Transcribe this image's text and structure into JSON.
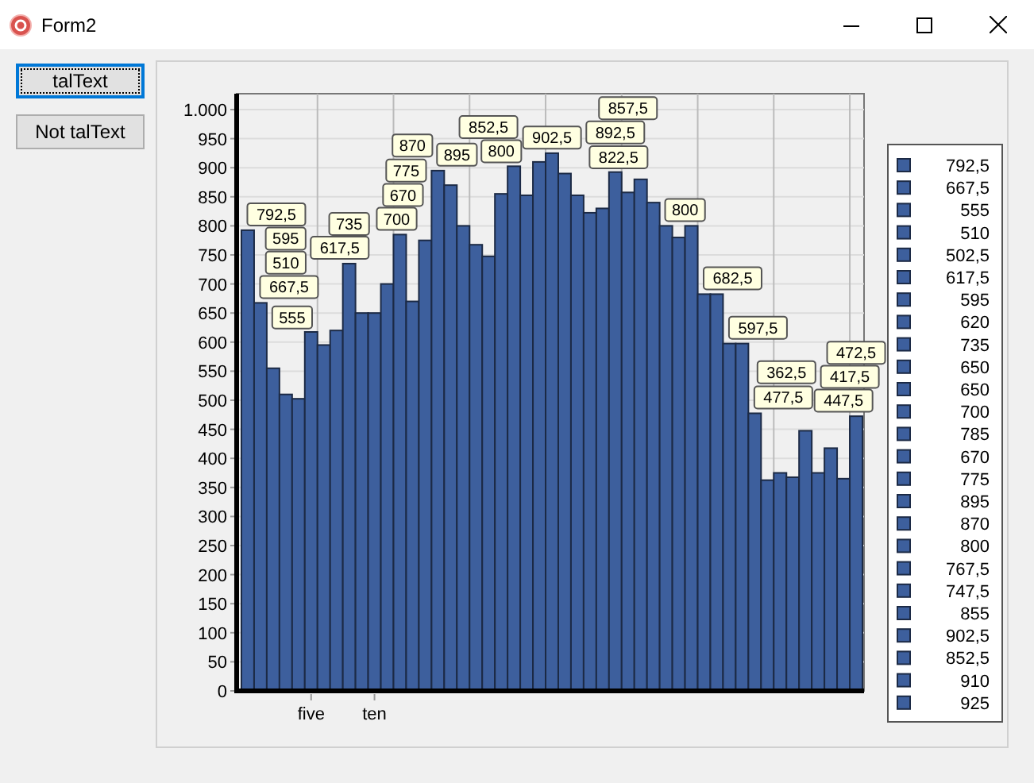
{
  "window": {
    "title": "Form2"
  },
  "buttons": [
    {
      "label": "talText",
      "focused": true
    },
    {
      "label": "Not talText",
      "focused": false
    }
  ],
  "chart": {
    "chart_data": {
      "type": "bar",
      "ylim": [
        0,
        1000
      ],
      "yticks": [
        0,
        50,
        100,
        150,
        200,
        250,
        300,
        350,
        400,
        450,
        500,
        550,
        600,
        650,
        700,
        750,
        800,
        850,
        900,
        950,
        {
          "value": 1000,
          "label": "1.000"
        }
      ],
      "grid": true,
      "categories": [
        null,
        null,
        null,
        null,
        null,
        "five",
        null,
        null,
        null,
        null,
        "ten",
        null,
        null,
        null,
        null,
        null,
        null,
        null,
        null,
        null,
        null,
        null,
        null,
        null,
        null,
        null,
        null,
        null,
        null,
        null,
        null,
        null,
        null,
        null,
        null,
        null,
        null,
        null,
        null,
        null,
        null,
        null,
        null,
        null,
        null,
        null,
        null,
        null,
        null
      ],
      "series": [
        {
          "color": "#3d5f9d",
          "values": [
            792.5,
            667.5,
            555,
            510,
            502.5,
            617.5,
            595,
            620,
            735,
            650,
            650,
            700,
            785,
            670,
            775,
            895,
            870,
            800,
            767.5,
            747.5,
            855,
            902.5,
            852.5,
            910,
            925,
            890,
            852.5,
            822.5,
            830,
            892.5,
            857.5,
            880,
            840,
            800,
            780,
            800,
            682.5,
            682.5,
            597.5,
            597.5,
            477.5,
            362.5,
            375,
            367.5,
            447.5,
            375,
            417.5,
            365,
            472.5
          ]
        }
      ],
      "value_labels": [
        "792,5",
        "667,5",
        "555",
        "510",
        null,
        "617,5",
        "595",
        null,
        "735",
        null,
        null,
        "700",
        null,
        "670",
        "775",
        "895",
        "870",
        "800",
        null,
        null,
        null,
        "902,5",
        "852,5",
        null,
        null,
        null,
        null,
        "822,5",
        null,
        "892,5",
        "857,5",
        null,
        null,
        "800",
        null,
        null,
        "682,5",
        null,
        "597,5",
        null,
        "477,5",
        "362,5",
        null,
        null,
        "447,5",
        null,
        "417,5",
        null,
        "472,5"
      ]
    },
    "legend": [
      "792,5",
      "667,5",
      "555",
      "510",
      "502,5",
      "617,5",
      "595",
      "620",
      "735",
      "650",
      "650",
      "700",
      "785",
      "670",
      "775",
      "895",
      "870",
      "800",
      "767,5",
      "747,5",
      "855",
      "902,5",
      "852,5",
      "910",
      "925"
    ]
  }
}
